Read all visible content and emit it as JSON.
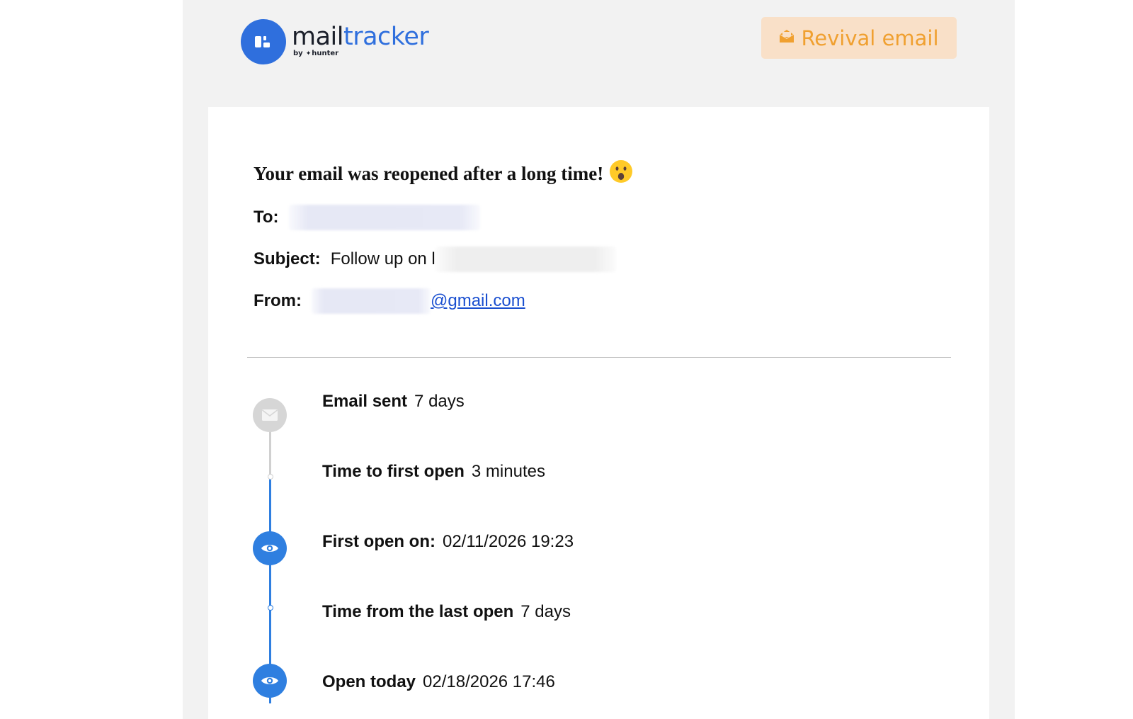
{
  "header": {
    "logo": {
      "word_part1": "mail",
      "word_part2": "tracker",
      "by_label": "by",
      "hunter_label": "hunter"
    },
    "revival_button": {
      "label": "Revival email",
      "icon": "envelope-open-icon"
    }
  },
  "card": {
    "title": "Your email was reopened after a long time!",
    "title_emoji": "😮",
    "to": {
      "label": "To:"
    },
    "subject": {
      "label": "Subject:",
      "value_visible": "Follow up on l"
    },
    "from": {
      "label": "From:",
      "value_visible": "@gmail.com"
    }
  },
  "timeline": {
    "items": [
      {
        "label": "Email sent",
        "value": "7 days",
        "icon": "envelope-icon"
      },
      {
        "label": "Time to first open",
        "value": "3 minutes"
      },
      {
        "label": "First open on:",
        "value": "02/11/2026 19:23",
        "icon": "eye-icon"
      },
      {
        "label": "Time from the last open",
        "value": "7 days"
      },
      {
        "label": "Open today",
        "value": "02/18/2026 17:46",
        "icon": "eye-icon"
      }
    ]
  },
  "colors": {
    "brand_blue": "#2f6fdd",
    "timeline_blue": "#2f7fe0",
    "revival_bg": "#f9e0c8",
    "revival_text": "#f0a030",
    "frame_bg": "#f2f2f2",
    "link_blue": "#1a4fd0"
  }
}
